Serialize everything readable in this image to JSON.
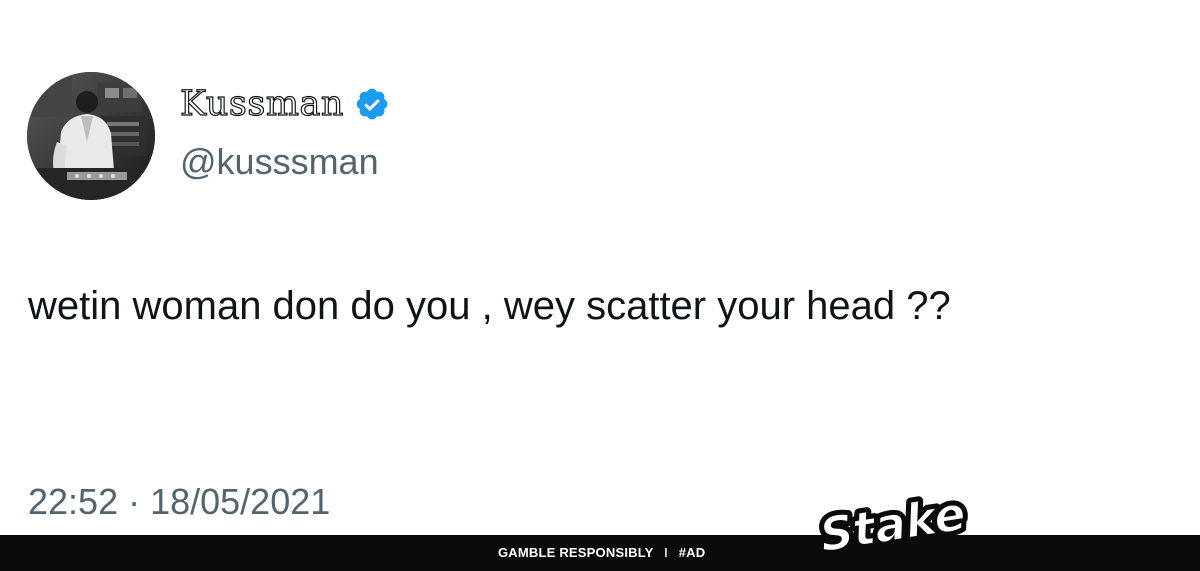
{
  "tweet": {
    "display_name": "Kussman",
    "handle": "@kusssman",
    "text": "wetin woman don do you , wey scatter your head ??",
    "timestamp": "22:52 · 18/05/2021",
    "verified": true,
    "verified_icon": "verified-badge-icon",
    "avatar_icon": "profile-avatar"
  },
  "ad": {
    "footer_left": "GAMBLE RESPONSIBLY",
    "footer_separator": "I",
    "footer_right": "#AD",
    "logo_text": "Stake"
  },
  "colors": {
    "text_primary": "#0f1419",
    "text_secondary": "#536471",
    "verified_blue": "#1d9bf0",
    "footer_bg": "#0b0b0b",
    "background": "#ffffff"
  }
}
